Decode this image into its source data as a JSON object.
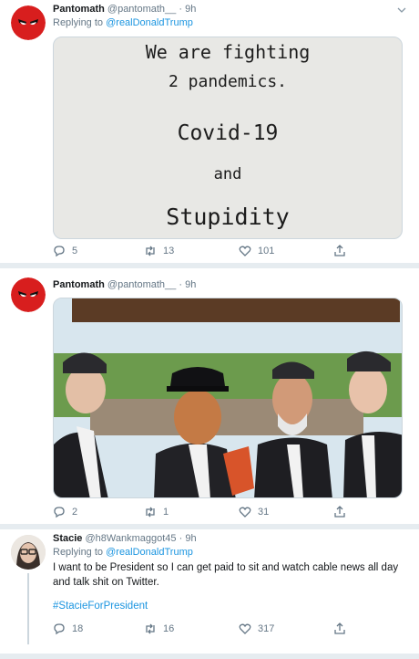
{
  "colors": {
    "link": "#1b95e0",
    "muted": "#657786",
    "text": "#14171a",
    "bg": "#e6ecf0"
  },
  "tweets": [
    {
      "name": "Pantomath",
      "handle": "@pantomath__",
      "dot": "·",
      "time": "9h",
      "reply_prefix": "Replying to",
      "reply_to": "@realDonaldTrump",
      "image_text": [
        "We are fighting",
        "2 pandemics.",
        "Covid-19",
        "and",
        "Stupidity"
      ],
      "replies": "5",
      "retweets": "13",
      "likes": "101"
    },
    {
      "name": "Pantomath",
      "handle": "@pantomath__",
      "dot": "·",
      "time": "9h",
      "image_desc_icon": "photo-of-pallbearers",
      "replies": "2",
      "retweets": "1",
      "likes": "31"
    },
    {
      "name": "Stacie",
      "handle": "@h8Wankmaggot45",
      "dot": "·",
      "time": "9h",
      "reply_prefix": "Replying to",
      "reply_to": "@realDonaldTrump",
      "text": "I want to be President so I can get paid to sit and watch cable news all day and talk shit on Twitter.",
      "hashtag": "#StacieForPresident",
      "replies": "18",
      "retweets": "16",
      "likes": "317"
    }
  ]
}
